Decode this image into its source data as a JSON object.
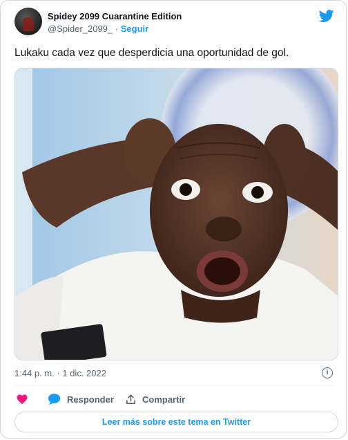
{
  "tweet": {
    "author_name": "Spidey 2099 Cuarantine Edition",
    "handle": "@Spider_2099_",
    "separator": "·",
    "follow_label": "Seguir",
    "text": "Lukaku cada vez que desperdicia una oportunidad de gol.",
    "timestamp": "1:44 p. m. · 1 dic. 2022",
    "info_glyph": "i"
  },
  "actions": {
    "reply_label": "Responder",
    "share_label": "Compartir"
  },
  "footer": {
    "read_more_label": "Leer más sobre este tema en Twitter"
  },
  "icons": {
    "logo": "twitter-bird-icon",
    "like": "heart-icon",
    "reply": "speech-bubble-icon",
    "share": "share-icon",
    "info": "info-icon"
  },
  "colors": {
    "accent": "#1d9bf0",
    "heart": "#f91880",
    "secondary_text": "#536471",
    "border": "#cfd9de"
  }
}
